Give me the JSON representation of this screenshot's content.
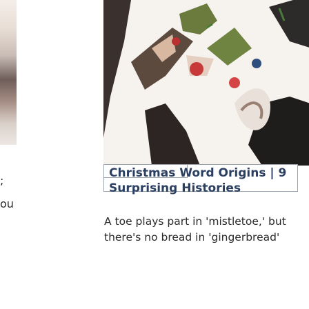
{
  "left_card": {
    "text_line_1": ";",
    "text_line_2": "ou"
  },
  "card": {
    "image_icon": "christmas-decorations-photo",
    "title_line_1": "Christmas Word Origins | 9",
    "title_line_2": "Surprising Histories",
    "description": "A toe plays part in 'mistletoe,' but there's no bread in 'gingerbread'"
  },
  "colors": {
    "title": "#2b3f63",
    "border": "#9aa3ad",
    "text": "#2a2a2a"
  }
}
